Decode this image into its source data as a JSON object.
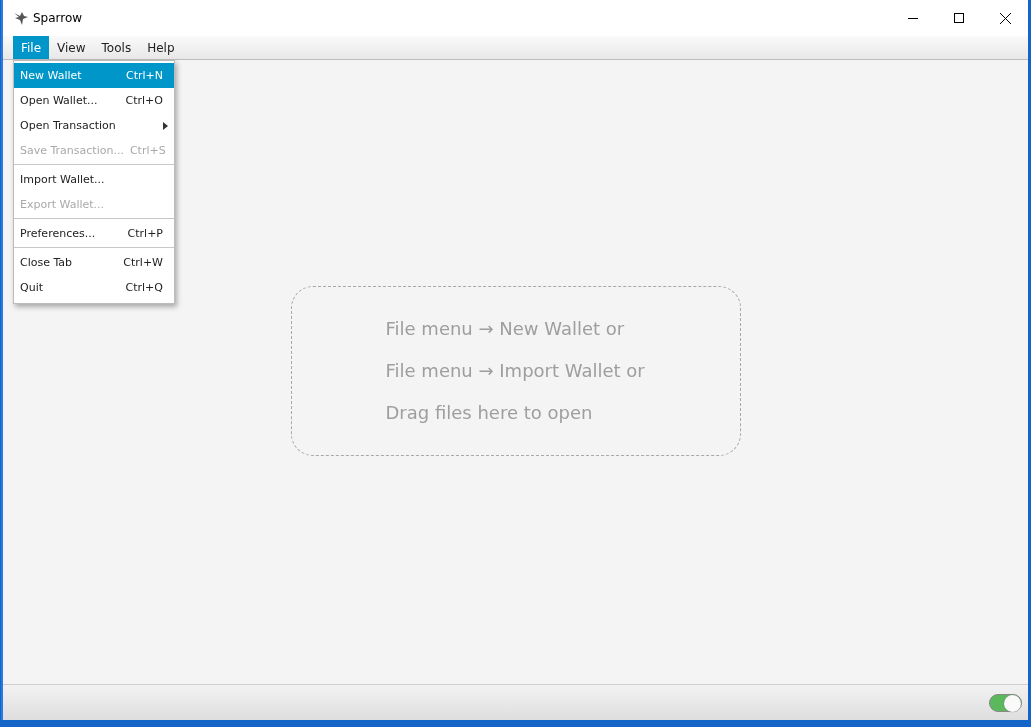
{
  "window": {
    "title": "Sparrow"
  },
  "menubar": [
    {
      "label": "File",
      "selected": true
    },
    {
      "label": "View",
      "selected": false
    },
    {
      "label": "Tools",
      "selected": false
    },
    {
      "label": "Help",
      "selected": false
    }
  ],
  "file_menu": [
    {
      "kind": "item",
      "label": "New Wallet",
      "shortcut": "Ctrl+N",
      "selected": true,
      "disabled": false
    },
    {
      "kind": "item",
      "label": "Open Wallet...",
      "shortcut": "Ctrl+O",
      "selected": false,
      "disabled": false
    },
    {
      "kind": "submenu",
      "label": "Open Transaction",
      "selected": false,
      "disabled": false
    },
    {
      "kind": "item",
      "label": "Save Transaction...",
      "shortcut": "Ctrl+S",
      "selected": false,
      "disabled": true
    },
    {
      "kind": "separator"
    },
    {
      "kind": "item",
      "label": "Import Wallet...",
      "selected": false,
      "disabled": false
    },
    {
      "kind": "item",
      "label": "Export Wallet...",
      "selected": false,
      "disabled": true
    },
    {
      "kind": "separator"
    },
    {
      "kind": "item",
      "label": "Preferences...",
      "shortcut": "Ctrl+P",
      "selected": false,
      "disabled": false
    },
    {
      "kind": "separator"
    },
    {
      "kind": "item",
      "label": "Close Tab",
      "shortcut": "Ctrl+W",
      "selected": false,
      "disabled": false
    },
    {
      "kind": "item",
      "label": "Quit",
      "shortcut": "Ctrl+Q",
      "selected": false,
      "disabled": false
    }
  ],
  "drop_zone": {
    "lines": [
      "File menu → New Wallet or",
      "File menu → Import Wallet or",
      "Drag files here to open"
    ]
  },
  "status_bar": {
    "toggle": {
      "on": true
    }
  }
}
